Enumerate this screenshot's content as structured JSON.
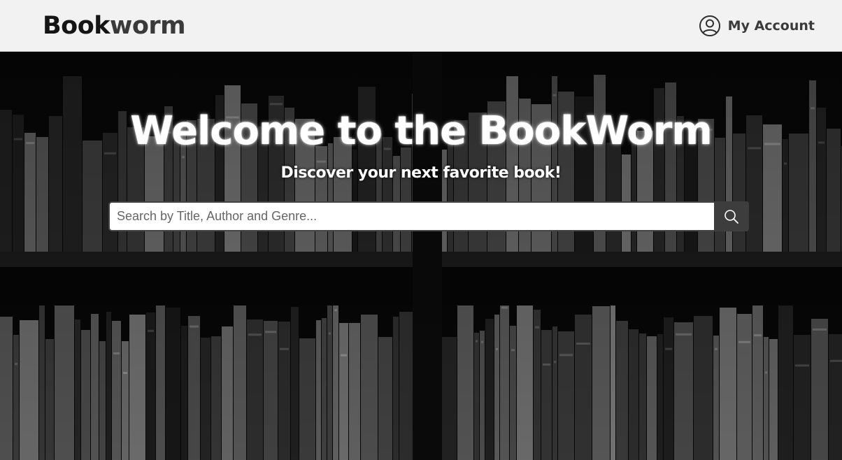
{
  "header": {
    "logo_part1": "Book",
    "logo_part2": "worm",
    "account_icon": "user-circle-icon",
    "account_label": "My Account"
  },
  "hero": {
    "background": "bookshelf-photo",
    "title": "Welcome to the BookWorm",
    "subtitle": "Discover your next favorite book!",
    "search": {
      "placeholder": "Search by Title, Author and Genre...",
      "value": "",
      "button_icon": "search-icon"
    }
  },
  "colors": {
    "header_bg": "#f2f2f2",
    "logo": "#151515",
    "search_button": "#3d3d3d",
    "hero_text": "#ffffff"
  }
}
